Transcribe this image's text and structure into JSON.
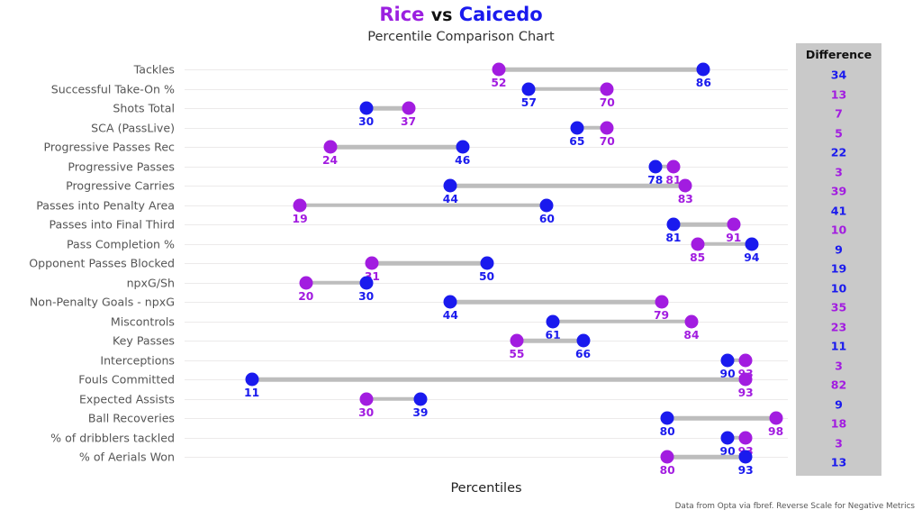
{
  "header": {
    "player1": "Rice",
    "vs": "vs",
    "player2": "Caicedo",
    "subtitle": "Percentile Comparison Chart"
  },
  "axis": {
    "x_label": "Percentiles"
  },
  "difference_panel": {
    "header": "Difference"
  },
  "source_note": "Data from Opta via fbref. Reverse Scale for Negative Metrics",
  "colors": {
    "player1": "#a21ce0",
    "player2": "#1a1aee",
    "connector": "#bdbdbd",
    "gridline": "#eceaea",
    "panel": "#c9c9c9"
  },
  "chart_data": {
    "type": "dumbbell",
    "title": "Rice vs Caicedo",
    "subtitle": "Percentile Comparison Chart",
    "xlabel": "Percentiles",
    "ylabel": "",
    "xlim": [
      0,
      100
    ],
    "grid": true,
    "legend": [
      "Rice",
      "Caicedo"
    ],
    "annotation": "Data from Opta via fbref. Reverse Scale for Negative Metrics",
    "categories": [
      "Tackles",
      "Successful Take-On %",
      "Shots Total",
      "SCA (PassLive)",
      "Progressive Passes Rec",
      "Progressive Passes",
      "Progressive Carries",
      "Passes into Penalty Area",
      "Passes into Final Third",
      "Pass Completion %",
      "Opponent Passes Blocked",
      "npxG/Sh",
      "Non-Penalty Goals - npxG",
      "Miscontrols",
      "Key Passes",
      "Interceptions",
      "Fouls Committed",
      "Expected Assists",
      "Ball Recoveries",
      "% of dribblers tackled",
      "% of Aerials Won"
    ],
    "series": [
      {
        "name": "Rice",
        "color": "#1a1aee",
        "values": [
          86,
          57,
          30,
          65,
          46,
          78,
          44,
          60,
          81,
          94,
          50,
          30,
          44,
          61,
          66,
          90,
          11,
          39,
          80,
          90,
          93
        ]
      },
      {
        "name": "Caicedo",
        "color": "#a21ce0",
        "values": [
          52,
          70,
          37,
          70,
          24,
          81,
          83,
          19,
          91,
          85,
          31,
          20,
          79,
          84,
          55,
          93,
          93,
          30,
          98,
          93,
          80
        ]
      }
    ],
    "differences": [
      34,
      13,
      7,
      5,
      22,
      3,
      39,
      41,
      10,
      9,
      19,
      10,
      35,
      23,
      11,
      3,
      82,
      9,
      18,
      3,
      13
    ],
    "difference_leader": [
      "p2",
      "p1",
      "p1",
      "p1",
      "p2",
      "p1",
      "p1",
      "p2",
      "p1",
      "p2",
      "p2",
      "p2",
      "p1",
      "p1",
      "p2",
      "p1",
      "p1",
      "p2",
      "p1",
      "p1",
      "p2"
    ]
  },
  "rows": [
    {
      "label": "Tackles",
      "p1": 52,
      "p2": 86,
      "diff": 34,
      "leader": "p2"
    },
    {
      "label": "Successful Take-On %",
      "p1": 70,
      "p2": 57,
      "diff": 13,
      "leader": "p1"
    },
    {
      "label": "Shots Total",
      "p1": 37,
      "p2": 30,
      "diff": 7,
      "leader": "p1"
    },
    {
      "label": "SCA (PassLive)",
      "p1": 70,
      "p2": 65,
      "diff": 5,
      "leader": "p1"
    },
    {
      "label": "Progressive Passes Rec",
      "p1": 24,
      "p2": 46,
      "diff": 22,
      "leader": "p2"
    },
    {
      "label": "Progressive Passes",
      "p1": 81,
      "p2": 78,
      "diff": 3,
      "leader": "p1"
    },
    {
      "label": "Progressive Carries",
      "p1": 83,
      "p2": 44,
      "diff": 39,
      "leader": "p1"
    },
    {
      "label": "Passes into Penalty Area",
      "p1": 19,
      "p2": 60,
      "diff": 41,
      "leader": "p2"
    },
    {
      "label": "Passes into Final Third",
      "p1": 91,
      "p2": 81,
      "diff": 10,
      "leader": "p1"
    },
    {
      "label": "Pass Completion %",
      "p1": 85,
      "p2": 94,
      "diff": 9,
      "leader": "p2"
    },
    {
      "label": "Opponent Passes Blocked",
      "p1": 31,
      "p2": 50,
      "diff": 19,
      "leader": "p2"
    },
    {
      "label": "npxG/Sh",
      "p1": 20,
      "p2": 30,
      "diff": 10,
      "leader": "p2"
    },
    {
      "label": "Non-Penalty Goals - npxG",
      "p1": 79,
      "p2": 44,
      "diff": 35,
      "leader": "p1"
    },
    {
      "label": "Miscontrols",
      "p1": 84,
      "p2": 61,
      "diff": 23,
      "leader": "p1"
    },
    {
      "label": "Key Passes",
      "p1": 55,
      "p2": 66,
      "diff": 11,
      "leader": "p2"
    },
    {
      "label": "Interceptions",
      "p1": 93,
      "p2": 90,
      "diff": 3,
      "leader": "p1"
    },
    {
      "label": "Fouls Committed",
      "p1": 93,
      "p2": 11,
      "diff": 82,
      "leader": "p1"
    },
    {
      "label": "Expected Assists",
      "p1": 30,
      "p2": 39,
      "diff": 9,
      "leader": "p2"
    },
    {
      "label": "Ball Recoveries",
      "p1": 98,
      "p2": 80,
      "diff": 18,
      "leader": "p1"
    },
    {
      "label": "% of dribblers tackled",
      "p1": 93,
      "p2": 90,
      "diff": 3,
      "leader": "p1"
    },
    {
      "label": "% of Aerials Won",
      "p1": 80,
      "p2": 93,
      "diff": 13,
      "leader": "p2"
    }
  ]
}
